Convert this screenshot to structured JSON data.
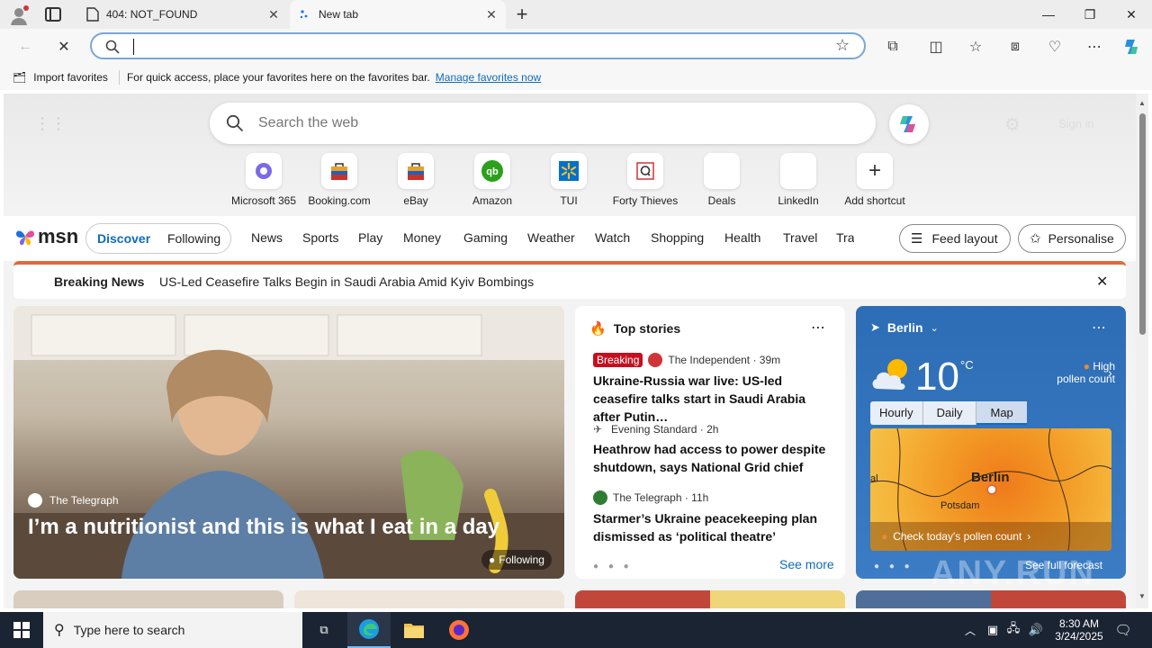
{
  "browser": {
    "tabs": [
      {
        "title": "404: NOT_FOUND"
      },
      {
        "title": "New tab"
      }
    ],
    "address": {
      "value": ""
    },
    "favbar": {
      "import_label": "Import favorites",
      "message": "For quick access, place your favorites here on the favorites bar.",
      "manage_link": "Manage favorites now"
    }
  },
  "newtab": {
    "search_placeholder": "Search the web",
    "signin": "Sign in",
    "shortcuts": [
      {
        "label": "Microsoft 365"
      },
      {
        "label": "Booking.com"
      },
      {
        "label": "eBay"
      },
      {
        "label": "Amazon"
      },
      {
        "label": "TUI"
      },
      {
        "label": "Forty Thieves"
      },
      {
        "label": "Deals"
      },
      {
        "label": "LinkedIn"
      },
      {
        "label": "Add shortcut"
      }
    ]
  },
  "msn": {
    "logo": "msn",
    "toggle": {
      "discover": "Discover",
      "following": "Following"
    },
    "nav": [
      "News",
      "Sports",
      "Play",
      "Money",
      "Gaming",
      "Weather",
      "Watch",
      "Shopping",
      "Health",
      "Travel",
      "Tra"
    ],
    "feed_layout": "Feed layout",
    "personalise": "Personalise",
    "breaking": {
      "label": "Breaking News",
      "text": "US-Led Ceasefire Talks Begin in Saudi Arabia Amid Kyiv Bombings"
    },
    "hero": {
      "source": "The Telegraph",
      "headline": "I’m a nutritionist and this is what I eat in a day",
      "following": "Following"
    },
    "top_stories": {
      "title": "Top stories",
      "stories": [
        {
          "badge": "Breaking",
          "source": "The Independent · 39m",
          "headline": "Ukraine-Russia war live: US-led ceasefire talks start in Saudi Arabia after Putin…"
        },
        {
          "source": "Evening Standard · 2h",
          "headline": "Heathrow had access to power despite shutdown, says National Grid chief"
        },
        {
          "source": "The Telegraph · 11h",
          "headline": "Starmer’s Ukraine peacekeeping plan dismissed as ‘political theatre’"
        }
      ],
      "see_more": "See more"
    },
    "weather": {
      "city": "Berlin",
      "temp": "10",
      "unit": "°C",
      "pollen_level": "High",
      "pollen_label": "pollen count",
      "tabs": [
        "Hourly",
        "Daily",
        "Map"
      ],
      "active_tab": "Map",
      "map_city": "Berlin",
      "map_place_1": "Potsdam",
      "map_place_2": "al",
      "pollen_cta": "Check today's pollen count",
      "full_forecast": "See full forecast"
    }
  },
  "taskbar": {
    "search_placeholder": "Type here to search",
    "time": "8:30 AM",
    "date": "3/24/2025"
  },
  "watermark": "ANY.RUN",
  "colors": {
    "accent": "#0f6cbd",
    "breaking_red": "#c50f1f",
    "taskbar": "#1b2433",
    "weather_bg": "#2d6db5"
  }
}
